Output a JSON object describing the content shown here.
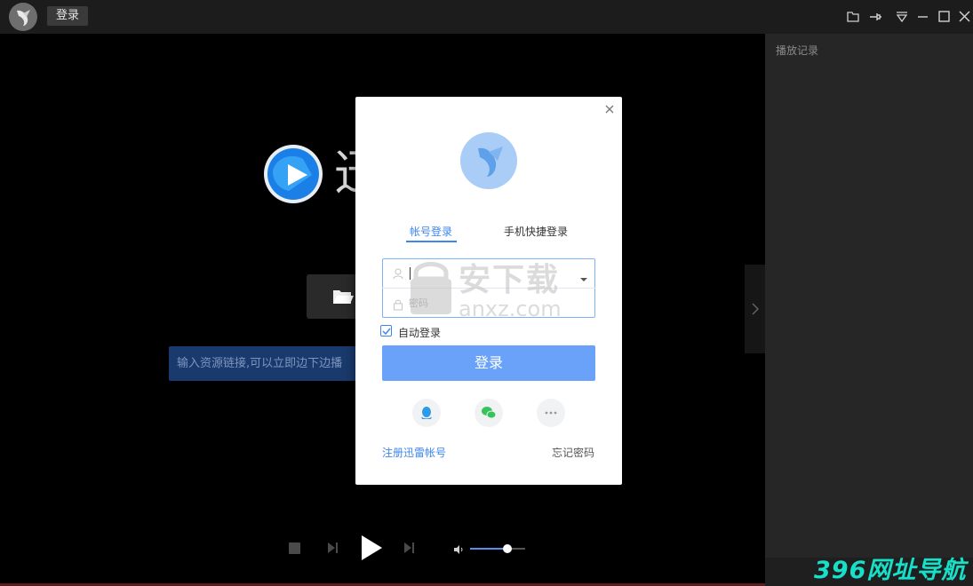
{
  "titlebar": {
    "login_label": "登录"
  },
  "player": {
    "brand_text": "迅",
    "link_input_placeholder": "输入资源链接,可以立即边下边播"
  },
  "side_panel": {
    "title": "播放记录"
  },
  "volume": {
    "level": 0.68
  },
  "dialog": {
    "tabs": [
      {
        "label": "帐号登录",
        "active": true
      },
      {
        "label": "手机快捷登录",
        "active": false
      }
    ],
    "account_value": "",
    "password_placeholder": "密码",
    "auto_login_label": "自动登录",
    "auto_login_checked": true,
    "submit_label": "登录",
    "register_link": "注册迅雷帐号",
    "forgot_link": "忘记密码"
  },
  "watermarks": {
    "anxz_cn": "安下载",
    "anxz_domain": "anxz.com",
    "site_396": "396网址导航"
  },
  "colors": {
    "accent": "#3d86f0",
    "submit_button": "#69a2f8",
    "link_input_bg": "#1a3a6e",
    "side_panel_bg": "#262626",
    "titlebar_bg": "#1c1c1c"
  },
  "icons": [
    "app-logo-icon",
    "folder-icon",
    "pin-icon",
    "menu-triangle-icon",
    "minimize-icon",
    "maximize-icon",
    "close-icon",
    "chevron-right-icon",
    "stop-icon",
    "previous-icon",
    "play-icon",
    "next-icon",
    "volume-icon",
    "user-icon",
    "lock-icon",
    "dropdown-arrow-icon",
    "qq-icon",
    "wechat-icon",
    "more-icon"
  ]
}
